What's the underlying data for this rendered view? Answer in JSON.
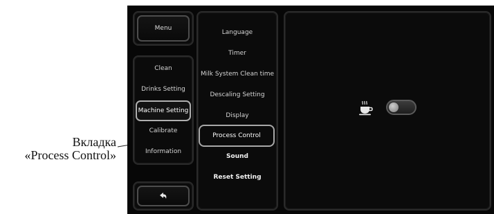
{
  "annotation": {
    "line1": "Вкладка",
    "line2": "«Process Control»"
  },
  "top": {
    "menu_label": "Menu"
  },
  "left_menu": {
    "items": [
      {
        "label": "Clean"
      },
      {
        "label": "Drinks Setting"
      },
      {
        "label": "Machine Setting",
        "selected": true
      },
      {
        "label": "Calibrate"
      },
      {
        "label": "Information"
      }
    ]
  },
  "back_button": {
    "icon": "back-arrow-icon"
  },
  "settings_menu": {
    "items": [
      {
        "label": "Language"
      },
      {
        "label": "Timer"
      },
      {
        "label": "Milk System Clean time"
      },
      {
        "label": "Descaling Setting"
      },
      {
        "label": "Display"
      },
      {
        "label": "Process Control",
        "selected": true
      },
      {
        "label": "Sound",
        "bold": true
      },
      {
        "label": "Reset Setting",
        "bold": true
      }
    ]
  },
  "content": {
    "icon": "coffee-cup-icon",
    "toggle": {
      "state": "off"
    }
  },
  "colors": {
    "screen_bg": "#070707",
    "border": "#4d4d4d",
    "selected_border": "#b0b0b0",
    "text": "#dcdcdc"
  }
}
